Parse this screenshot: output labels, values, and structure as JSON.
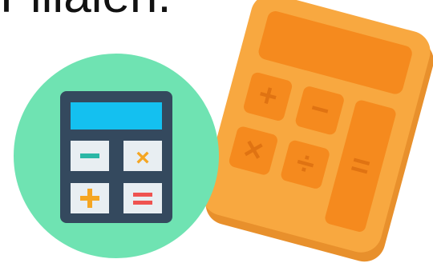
{
  "caption": {
    "text": "Filialen."
  },
  "icons": {
    "green_calculator": {
      "name": "calculator-icon",
      "circle_color": "#6FE3B2",
      "body_color": "#34495E",
      "display_color": "#14C0F0",
      "key_color": "#E8EEF2",
      "key_glyphs": [
        "−",
        "×",
        "+",
        "="
      ],
      "glyph_colors": [
        "#2BB7A6",
        "#F5A623",
        "#F5A623",
        "#EF5350"
      ]
    },
    "orange_calculator": {
      "name": "calculator-icon",
      "body_color": "#F8A840",
      "shadow_color": "#E8902C",
      "key_color": "#F58A1E",
      "glyph_color": "#E07312",
      "key_glyphs": [
        "+",
        "−",
        "×",
        "÷",
        "="
      ]
    }
  }
}
